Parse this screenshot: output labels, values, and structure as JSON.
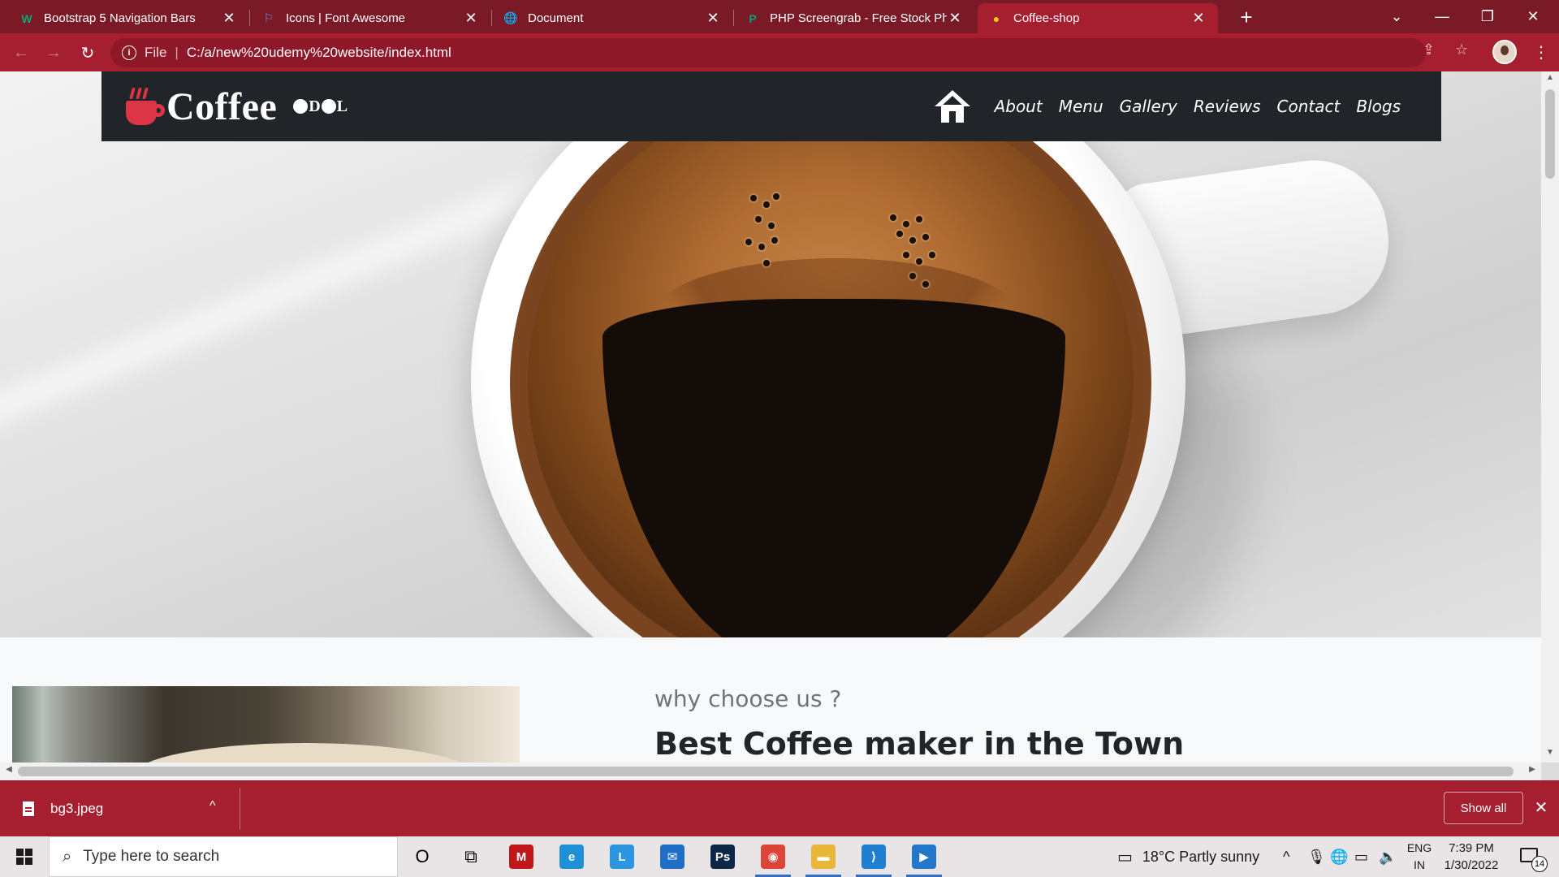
{
  "browser": {
    "tabs": [
      {
        "title": "Bootstrap 5 Navigation Bars",
        "favicon": "w3schools-icon",
        "fav_glyph": "W",
        "fav_color": "#04aa6d"
      },
      {
        "title": "Icons | Font Awesome",
        "favicon": "font-awesome-flag-icon",
        "fav_glyph": "⚐",
        "fav_color": "#6e8cff"
      },
      {
        "title": "Document",
        "favicon": "globe-icon",
        "fav_glyph": "🌐",
        "fav_color": "#ffffff"
      },
      {
        "title": "PHP Screengrab - Free Stock Phot",
        "favicon": "pexels-icon",
        "fav_glyph": "P",
        "fav_color": "#05a081"
      },
      {
        "title": "Coffee-shop",
        "favicon": "coffee-favicon",
        "fav_glyph": "●",
        "fav_color": "#f5c518"
      }
    ],
    "active_tab_index": 4,
    "close_glyph": "✕",
    "new_tab_glyph": "+",
    "address": {
      "scheme_label": "File",
      "url": "C:/a/new%20udemy%20website/index.html",
      "separator": "|"
    },
    "window_controls": {
      "tab_search": "⌄",
      "minimize": "—",
      "restore": "❐",
      "close": "✕"
    },
    "nav": {
      "back": "←",
      "forward": "→",
      "reload": "↻",
      "info": "i",
      "share": "⇪",
      "star": "☆",
      "menu": "⋮"
    }
  },
  "site": {
    "brand": {
      "name": "Coffee",
      "sub_letters": [
        "D",
        "L"
      ]
    },
    "nav_links": [
      "About",
      "Menu",
      "Gallery",
      "Reviews",
      "Contact",
      "Blogs"
    ],
    "section": {
      "kicker": "why choose us ?",
      "title": "Best Coffee maker in the Town"
    }
  },
  "download_shelf": {
    "file_name": "bg3.jpeg",
    "caret": "^",
    "show_all_label": "Show all",
    "close_glyph": "✕"
  },
  "taskbar": {
    "search_placeholder": "Type here to search",
    "search_glyph": "⌕",
    "cortana_glyph": "O",
    "taskview_glyph": "⧉",
    "weather": "18°C  Partly sunny",
    "tray_arrow": "^",
    "lang_line1": "ENG",
    "lang_line2": "IN",
    "time": "7:39 PM",
    "date": "1/30/2022",
    "notification_count": "14",
    "apps": [
      {
        "name": "mcafee-icon",
        "glyph": "M",
        "bg": "#c01818",
        "active": false
      },
      {
        "name": "edge-icon",
        "glyph": "e",
        "bg": "#1f8fd6",
        "active": false
      },
      {
        "name": "lark-icon",
        "glyph": "L",
        "bg": "#2c95e0",
        "active": false
      },
      {
        "name": "mail-icon",
        "glyph": "✉",
        "bg": "#1f6fc6",
        "active": false
      },
      {
        "name": "photoshop-icon",
        "glyph": "Ps",
        "bg": "#0c2747",
        "active": false
      },
      {
        "name": "chrome-icon",
        "glyph": "◉",
        "bg": "#db4437",
        "active": true
      },
      {
        "name": "file-explorer-icon",
        "glyph": "▬",
        "bg": "#e8b73a",
        "active": true
      },
      {
        "name": "vscode-icon",
        "glyph": "⟩",
        "bg": "#1f7fd0",
        "active": true
      },
      {
        "name": "media-player-icon",
        "glyph": "▶",
        "bg": "#2476c9",
        "active": true
      }
    ]
  },
  "colors": {
    "chrome_tabstrip": "#7a1a26",
    "chrome_toolbar": "#a61f30",
    "navbar_bg": "#212529",
    "brand_accent": "#dc3545"
  }
}
